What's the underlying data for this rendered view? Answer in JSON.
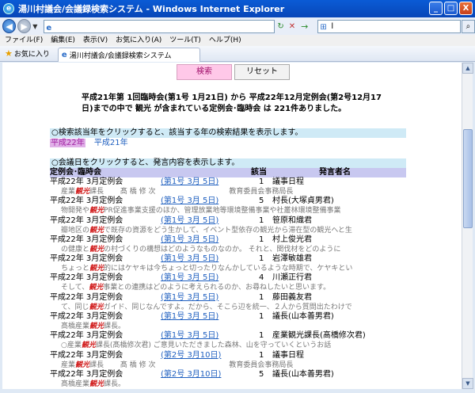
{
  "window": {
    "title": "湯川村議会/会議録検索システム - Windows Internet Explorer",
    "minimize": "_",
    "maximize": "□",
    "close": "X"
  },
  "toolbar": {
    "back": "◀",
    "forward": "▶",
    "dropdown": "▼",
    "refresh": "↻",
    "stop": "✕",
    "go": "→",
    "search_value": "l",
    "search_go": "⌕"
  },
  "menu": [
    "ファイル(F)",
    "編集(E)",
    "表示(V)",
    "お気に入り(A)",
    "ツール(T)",
    "ヘルプ(H)"
  ],
  "favorites": {
    "label": "お気に入り",
    "tab_title": "湯川村議会/会議録検索システム"
  },
  "buttons": {
    "search": "検索",
    "reset": "リセット"
  },
  "summary": "平成21年第 1回臨時会(第1号 1月21日) から 平成22年12月定例会(第2号12月17日)までの中で 観光 が含まれている定例会･臨時会 は 221件ありました。",
  "info1": "○検索該当年をクリックすると、該当する年の検索結果を表示します。",
  "years": {
    "selected": "平成22年",
    "other": "平成21年"
  },
  "info2": "○会議日をクリックすると、発言内容を表示します。",
  "table_headers": {
    "session": "定例会･臨時会",
    "count": "該当",
    "speaker": "発言者名"
  },
  "records": [
    {
      "date": "平成22年 3月定例会",
      "num": "(第1号 3月 5日)",
      "count": "1",
      "speaker": "議事日程",
      "snip_pre": "産業",
      "kw": "観光",
      "snip_post": "課長 　　髙 橋 修 次 　　　　　　　　　　教育委員会事務局長"
    },
    {
      "date": "平成22年 3月定例会",
      "num": "(第1号 3月 5日)",
      "count": "5",
      "speaker": "村長(大塚貞男君)",
      "snip_pre": "物開発や",
      "kw": "観光",
      "snip_post": "PR促進事業支援のほか、管理放業地等環境整備事業や社叢林環境整備事業"
    },
    {
      "date": "平成22年 3月定例会",
      "num": "(第1号 3月 5日)",
      "count": "1",
      "speaker": "笹原和織君",
      "snip_pre": "瓣地区の",
      "kw": "観光",
      "snip_post": "で既存の資源をどう生かして、イベント型依存の観光から滞在型の観光へと生"
    },
    {
      "date": "平成22年 3月定例会",
      "num": "(第1号 3月 5日)",
      "count": "1",
      "speaker": "村上俊光君",
      "snip_pre": "の健康と",
      "kw": "観光",
      "snip_post": "の村づくりの構想はどのようなものなのか。 それと、関伐材をどのように"
    },
    {
      "date": "平成22年 3月定例会",
      "num": "(第1号 3月 5日)",
      "count": "1",
      "speaker": "岩澤敏雄君",
      "snip_pre": "ちょっと",
      "kw": "観光",
      "snip_post": "的にはケヤキは今ちょっと切ったりなんかしているような時期で、ケヤキとい"
    },
    {
      "date": "平成22年 3月定例会",
      "num": "(第1号 3月 5日)",
      "count": "4",
      "speaker": "川瀬正行君",
      "snip_pre": "そして、",
      "kw": "観光",
      "snip_post": "事業との連携はどのように考えられるのか、お尋ねしたいと思います。"
    },
    {
      "date": "平成22年 3月定例会",
      "num": "(第1号 3月 5日)",
      "count": "1",
      "speaker": "藤田義友君",
      "snip_pre": "て、同じ",
      "kw": "観光",
      "snip_post": "ガイド、同じなんですよ。だから、そこら辺を統一、２人から質問出たわけで"
    },
    {
      "date": "平成22年 3月定例会",
      "num": "(第1号 3月 5日)",
      "count": "1",
      "speaker": "議長(山本善男君)",
      "snip_pre": "髙橋産業",
      "kw": "観光",
      "snip_post": "課長。"
    },
    {
      "date": "平成22年 3月定例会",
      "num": "(第1号 3月 5日)",
      "count": "1",
      "speaker": "産業観光課長(髙橋修次君)",
      "snip_pre": "○産業",
      "kw": "観光",
      "snip_post": "課長(髙橋修次君) ご意見いただきました森林、山を守っていくというお話"
    },
    {
      "date": "平成22年 3月定例会",
      "num": "(第2号 3月10日)",
      "count": "1",
      "speaker": "議事日程",
      "snip_pre": "産業",
      "kw": "観光",
      "snip_post": "課長 　　髙 橋 修 次 　　　　　　　　　　教育委員会事務局長"
    },
    {
      "date": "平成22年 3月定例会",
      "num": "(第2号 3月10日)",
      "count": "5",
      "speaker": "議長(山本善男君)",
      "snip_pre": "髙橋産業",
      "kw": "観光",
      "snip_post": "課長。"
    }
  ]
}
